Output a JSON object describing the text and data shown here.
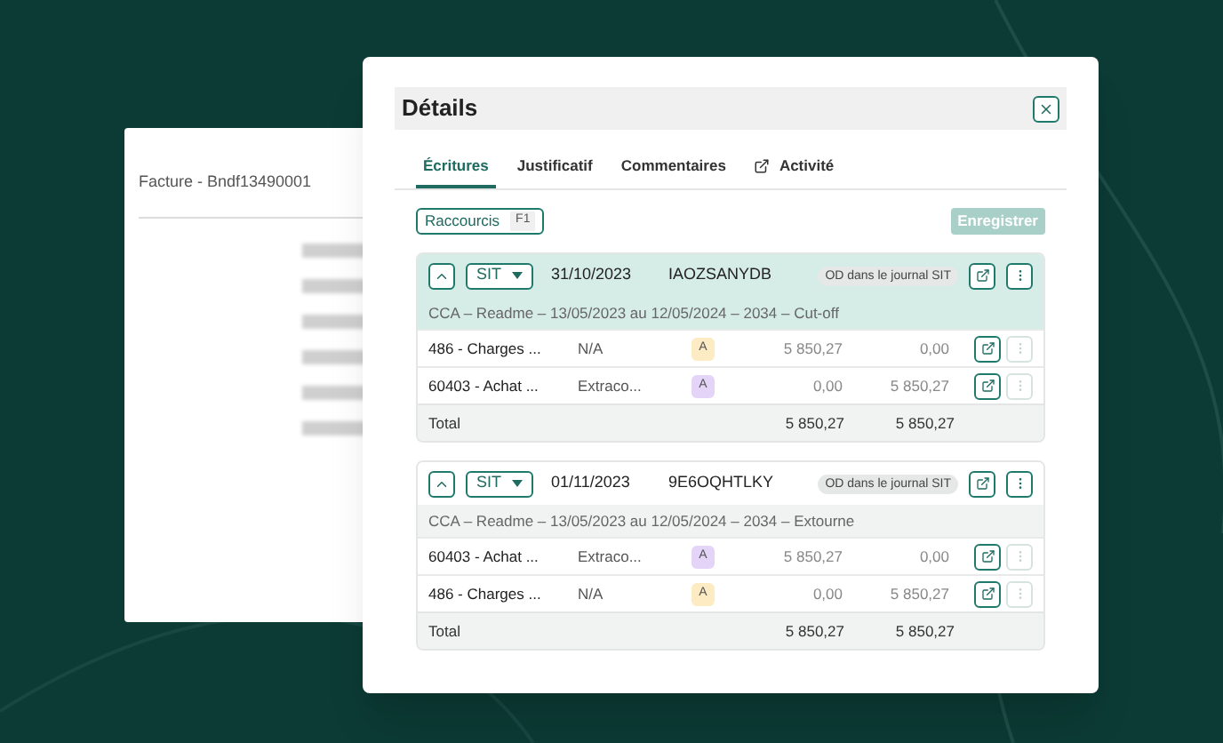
{
  "background_document": {
    "title": "Facture - Bndf13490001"
  },
  "dialog": {
    "title": "Détails"
  },
  "tabs": [
    {
      "label": "Écritures",
      "selected": true,
      "kind": "plain"
    },
    {
      "label": "Justificatif",
      "selected": false,
      "kind": "plain"
    },
    {
      "label": "Commentaires",
      "selected": false,
      "kind": "plain"
    },
    {
      "label": "Activité",
      "selected": false,
      "kind": "external"
    }
  ],
  "shortcuts_button": {
    "label": "Raccourcis",
    "key": "F1"
  },
  "save_button": {
    "label": "Enregistrer",
    "disabled": true
  },
  "entries": [
    {
      "selected": true,
      "expanded": true,
      "journal": "SIT",
      "date": "31/10/2023",
      "reference": "IAOZSANYDB",
      "badge": "OD dans le journal SIT",
      "description": "CCA – Readme – 13/05/2023 au 12/05/2024 – 2034 – Cut-off",
      "lines": [
        {
          "account": "486 - Charges ...",
          "label": "N/A",
          "tag": "A",
          "color": "#fdebc4",
          "debit": "5 850,27",
          "credit": "0,00"
        },
        {
          "account": "60403 - Achat ...",
          "label": "Extraco...",
          "tag": "A",
          "color": "#e4d4f7",
          "debit": "0,00",
          "credit": "5 850,27"
        }
      ],
      "total_label": "Total",
      "total_debit": "5 850,27",
      "total_credit": "5 850,27"
    },
    {
      "selected": false,
      "expanded": true,
      "journal": "SIT",
      "date": "01/11/2023",
      "reference": "9E6OQHTLKY",
      "badge": "OD dans le journal SIT",
      "description": "CCA – Readme – 13/05/2023 au 12/05/2024 – 2034 – Extourne",
      "lines": [
        {
          "account": "60403 - Achat ...",
          "label": "Extraco...",
          "tag": "A",
          "color": "#e4d4f7",
          "debit": "5 850,27",
          "credit": "0,00"
        },
        {
          "account": "486 - Charges ...",
          "label": "N/A",
          "tag": "A",
          "color": "#fdebc4",
          "debit": "0,00",
          "credit": "5 850,27"
        }
      ],
      "total_label": "Total",
      "total_debit": "5 850,27",
      "total_credit": "5 850,27"
    }
  ]
}
